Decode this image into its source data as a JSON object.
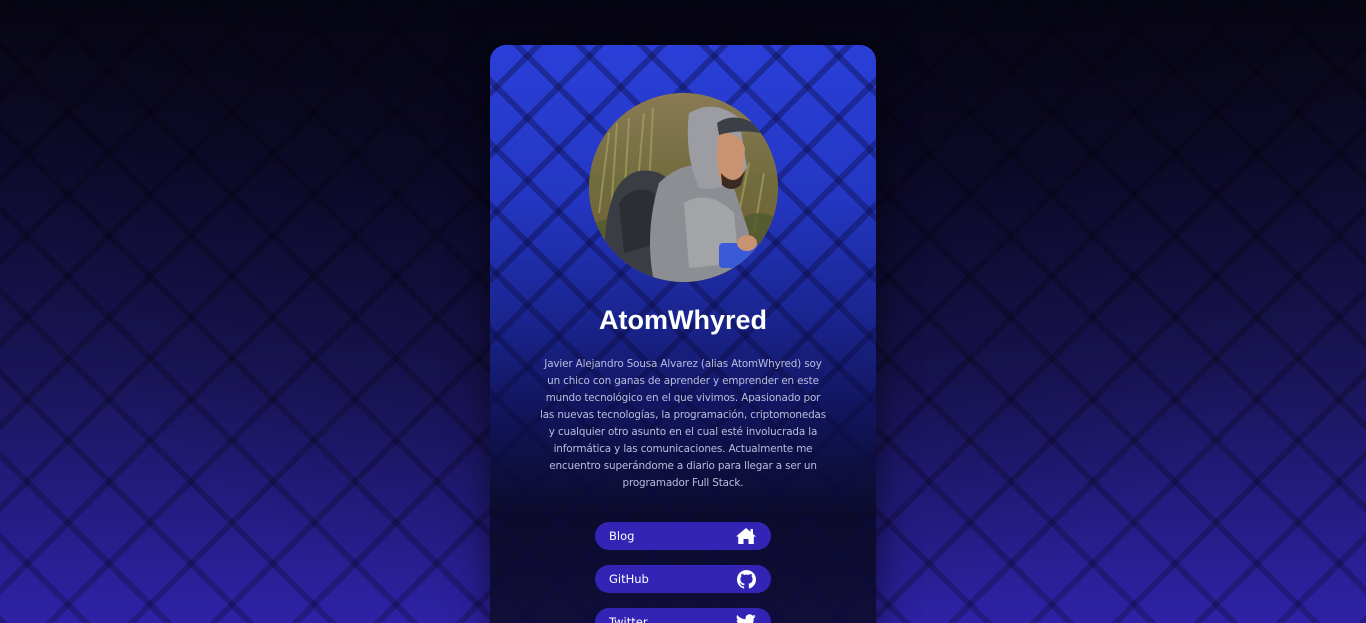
{
  "profile": {
    "name": "AtomWhyred",
    "bio": "Javier Alejandro Sousa Alvarez (alias AtomWhyred) soy un chico con ganas de aprender y emprender en este mundo tecnológico en el que vivimos. Apasionado por las nuevas tecnologías, la programación, criptomonedas y cualquier otro asunto en el cual esté involucrada la informática y las comunicaciones. Actualmente me encuentro superándome a diario para llegar a ser un programador Full Stack."
  },
  "links": [
    {
      "label": "Blog",
      "icon": "home-icon"
    },
    {
      "label": "GitHub",
      "icon": "github-icon"
    },
    {
      "label": "Twitter",
      "icon": "twitter-icon"
    }
  ],
  "colors": {
    "card_top": "#2a3fd8",
    "card_bottom": "#0c0b2c",
    "button_bg": "#3424b6",
    "text_primary": "#ffffff",
    "text_bio": "#b9bedc"
  }
}
